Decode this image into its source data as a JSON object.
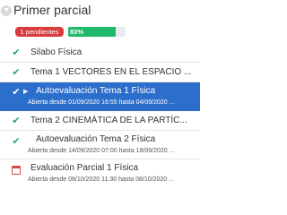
{
  "header": {
    "toggle_icon": "chevron-down-icon",
    "title": "Primer parcial"
  },
  "status": {
    "pending_badge": "1 pendientes",
    "progress_label": "83%",
    "progress_percent": 83
  },
  "items": [
    {
      "label": "Silabo Física",
      "icon": "check-icon"
    },
    {
      "label": "Tema 1 VECTORES EN EL ESPACIO ...",
      "icon": "check-icon"
    },
    {
      "label": "Autoevaluación Tema 1 Física",
      "sub": "Abierta desde 01/09/2020 16:55 hasta 04/09/2020 ...",
      "icon": "check-icon",
      "active": true
    },
    {
      "label": "Tema 2 CINEMÁTICA DE LA PARTÍC...",
      "icon": "check-icon"
    },
    {
      "label": "Autoevaluación Tema 2 Física",
      "sub": "Abierta desde 14/09/2020 07:00 hasta 18/09/2020 ...",
      "icon": "check-icon"
    },
    {
      "label": "Evaluación Parcial 1 Física",
      "sub": "Abierta desde 08/10/2020 11:30 hasta 08/10/2020 ...",
      "icon": "calendar-icon"
    }
  ],
  "colors": {
    "accent": "#2c6ecb",
    "success": "#21b96b",
    "danger": "#d93c3c"
  }
}
